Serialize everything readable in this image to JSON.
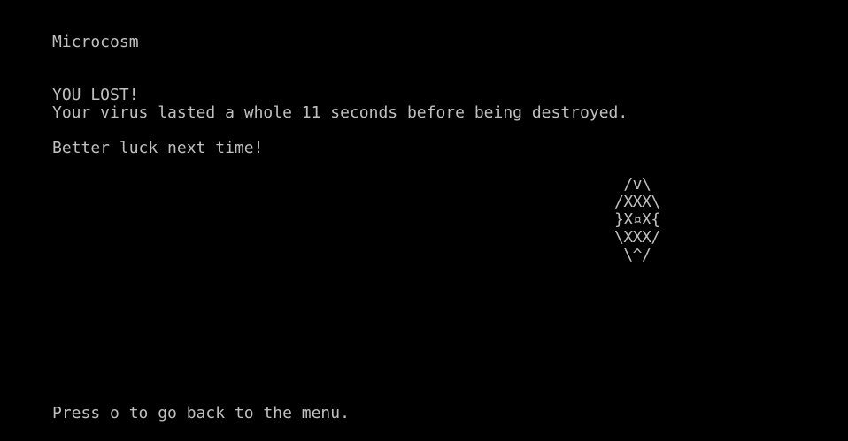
{
  "screen": {
    "title": "Microcosm",
    "lost_heading": "YOU LOST!",
    "lost_message": "Your virus lasted a whole 11 seconds before being destroyed.",
    "encouragement": "Better luck next time!",
    "prompt": "Press o to go back to the menu."
  },
  "virus_art": " /v\\\n/XXX\\\n}X¤X{\n\\XXX/\n \\^/",
  "colors": {
    "background": "#000000",
    "text": "#c0c0c0"
  }
}
